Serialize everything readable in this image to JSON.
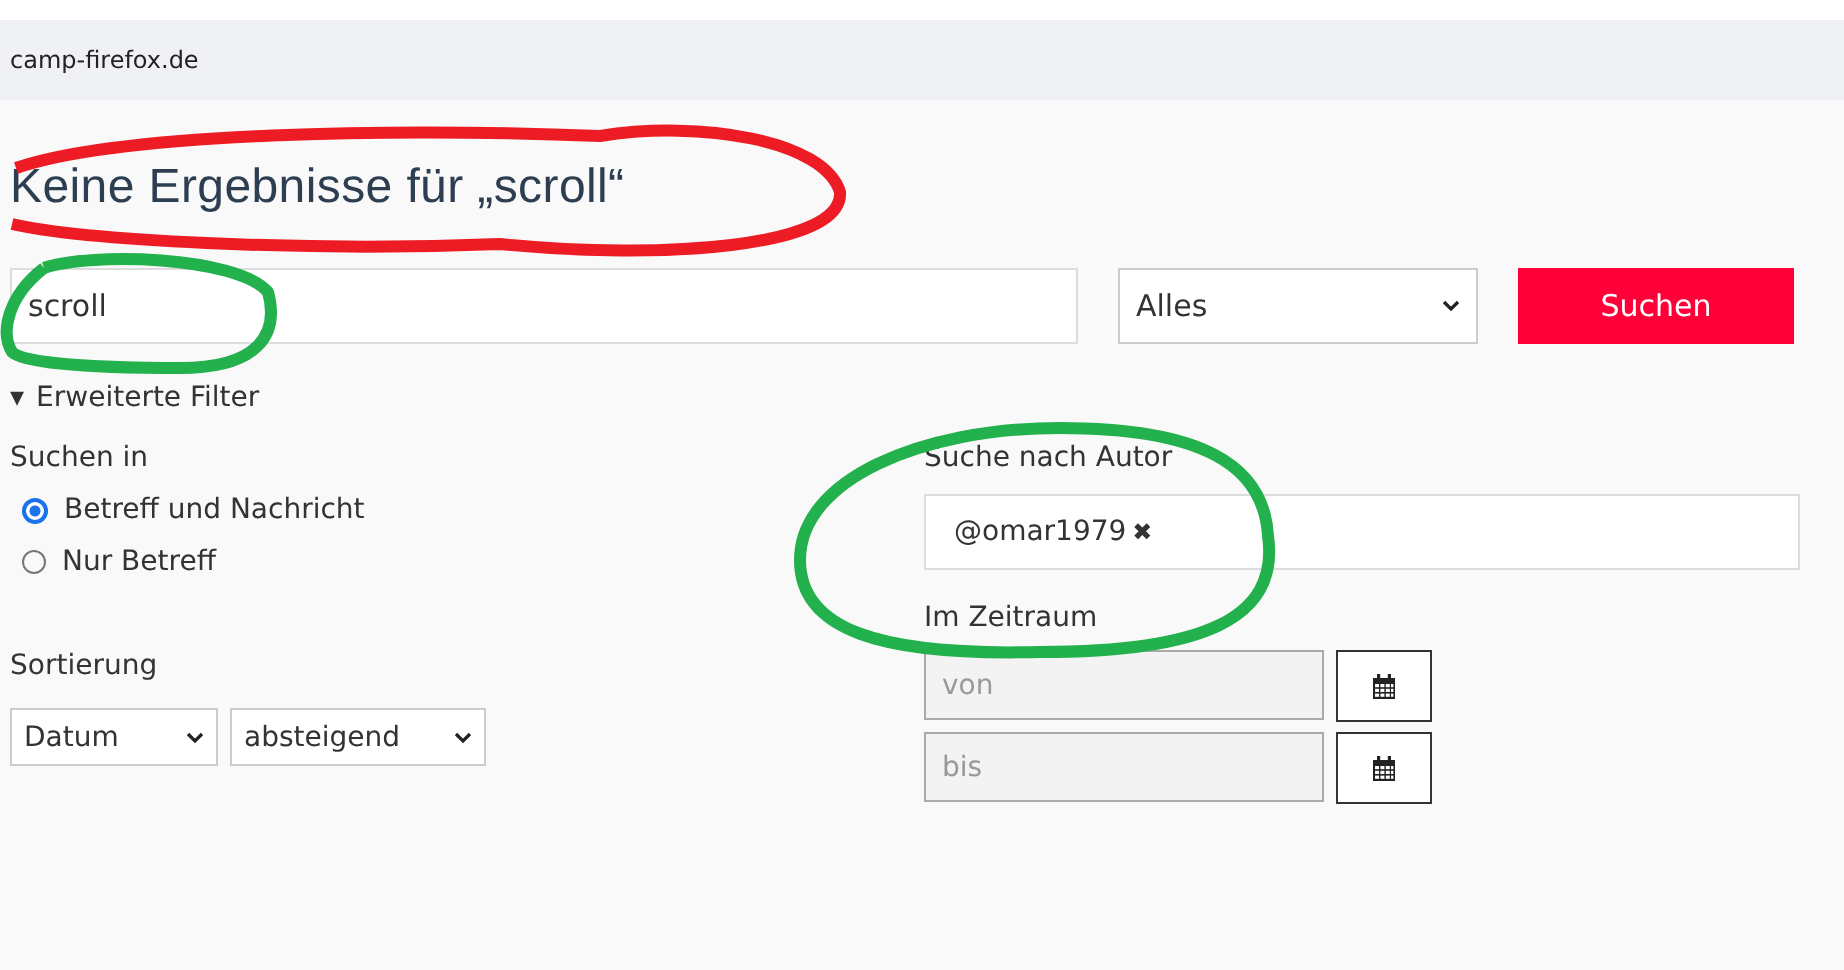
{
  "site": {
    "title": "camp-firefox.de"
  },
  "heading": "Keine Ergebnisse für „scroll“",
  "search": {
    "value": "scroll",
    "scope": "Alles",
    "button": "Suchen"
  },
  "filters": {
    "toggle_icon": "▾",
    "label": "Erweiterte Filter",
    "expanded": true
  },
  "search_in": {
    "label": "Suchen in",
    "options": [
      {
        "label": "Betreff und Nachricht",
        "selected": true
      },
      {
        "label": "Nur Betreff",
        "selected": false
      }
    ]
  },
  "sort": {
    "label": "Sortierung",
    "field": "Datum",
    "order": "absteigend"
  },
  "author": {
    "label": "Suche nach Autor",
    "tags": [
      {
        "label": "@omar1979",
        "remove": "✖"
      }
    ]
  },
  "period": {
    "label": "Im Zeitraum",
    "fields": [
      {
        "placeholder": "von",
        "disabled": true
      },
      {
        "placeholder": "bis",
        "disabled": true
      }
    ]
  },
  "annotations": [
    {
      "color": "#ed1c24"
    },
    {
      "color": "#22b14c"
    },
    {
      "color": "#22b14c"
    }
  ]
}
